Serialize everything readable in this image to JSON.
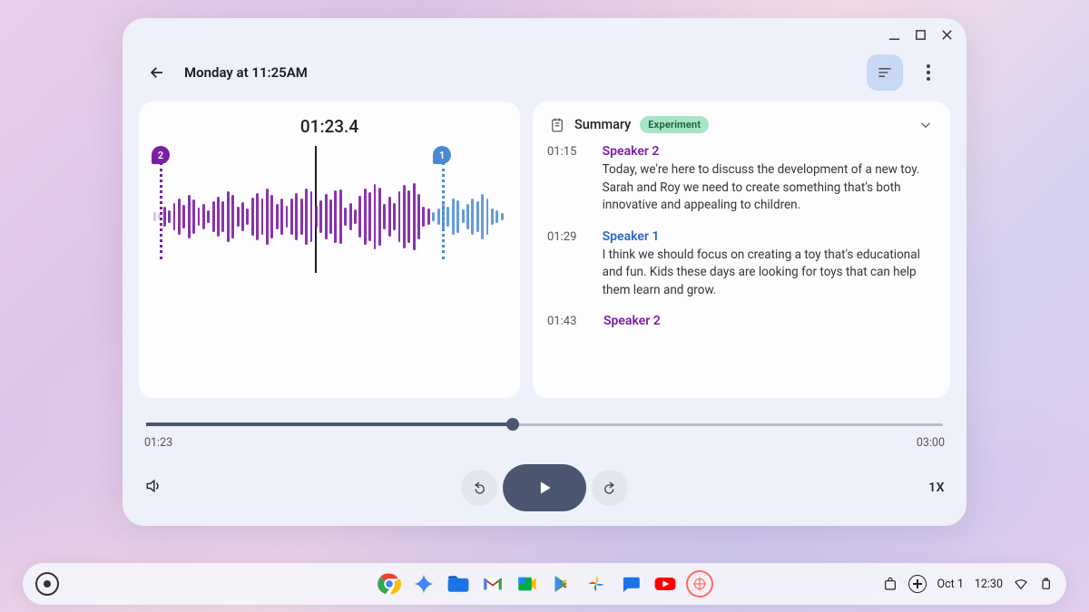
{
  "window": {
    "title": "Monday at 11:25AM"
  },
  "waveform": {
    "timecode": "01:23.4",
    "marker2": "2",
    "marker1": "1"
  },
  "summary": {
    "label": "Summary",
    "badge": "Experiment"
  },
  "transcript": [
    {
      "time": "01:15",
      "speaker": "Speaker 2",
      "speaker_class": "s2",
      "text": "Today, we're here to discuss the development of a new toy. Sarah and Roy we need to create something that's both innovative and appealing to children."
    },
    {
      "time": "01:29",
      "speaker": "Speaker 1",
      "speaker_class": "s1",
      "text": "I think we should focus on creating a toy that's educational and fun. Kids these days are looking for toys that can help them learn and grow."
    },
    {
      "time": "01:43",
      "speaker": "Speaker 2",
      "speaker_class": "s2",
      "text": ""
    }
  ],
  "player": {
    "elapsed": "01:23",
    "total": "03:00",
    "progress_pct": 46,
    "speed": "1X"
  },
  "taskbar": {
    "date": "Oct 1",
    "time": "12:30"
  }
}
